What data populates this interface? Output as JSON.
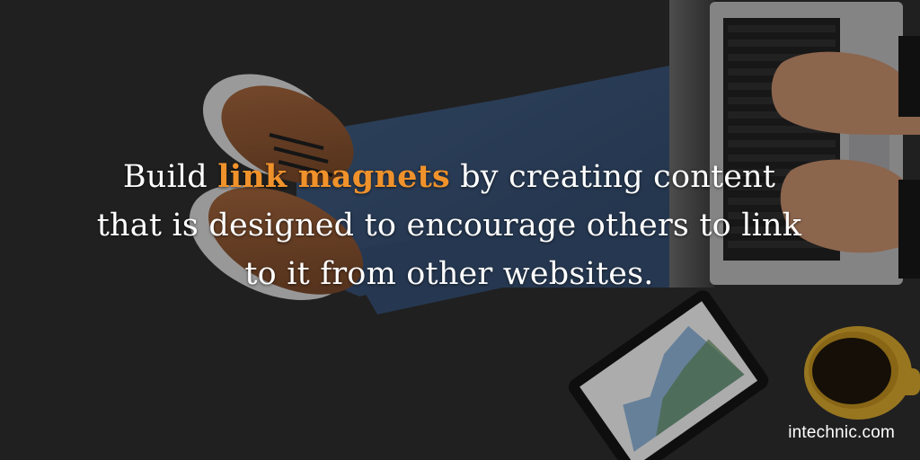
{
  "quote": {
    "line1_before": "Build ",
    "line1_highlight": "link magnets",
    "line1_after": " by creating content",
    "line2": "that is designed to encourage others to link",
    "line3": "to it from other websites."
  },
  "brand": "intechnic.com",
  "colors": {
    "highlight": "#f0922b",
    "text": "#ffffff",
    "background": "#272727"
  }
}
